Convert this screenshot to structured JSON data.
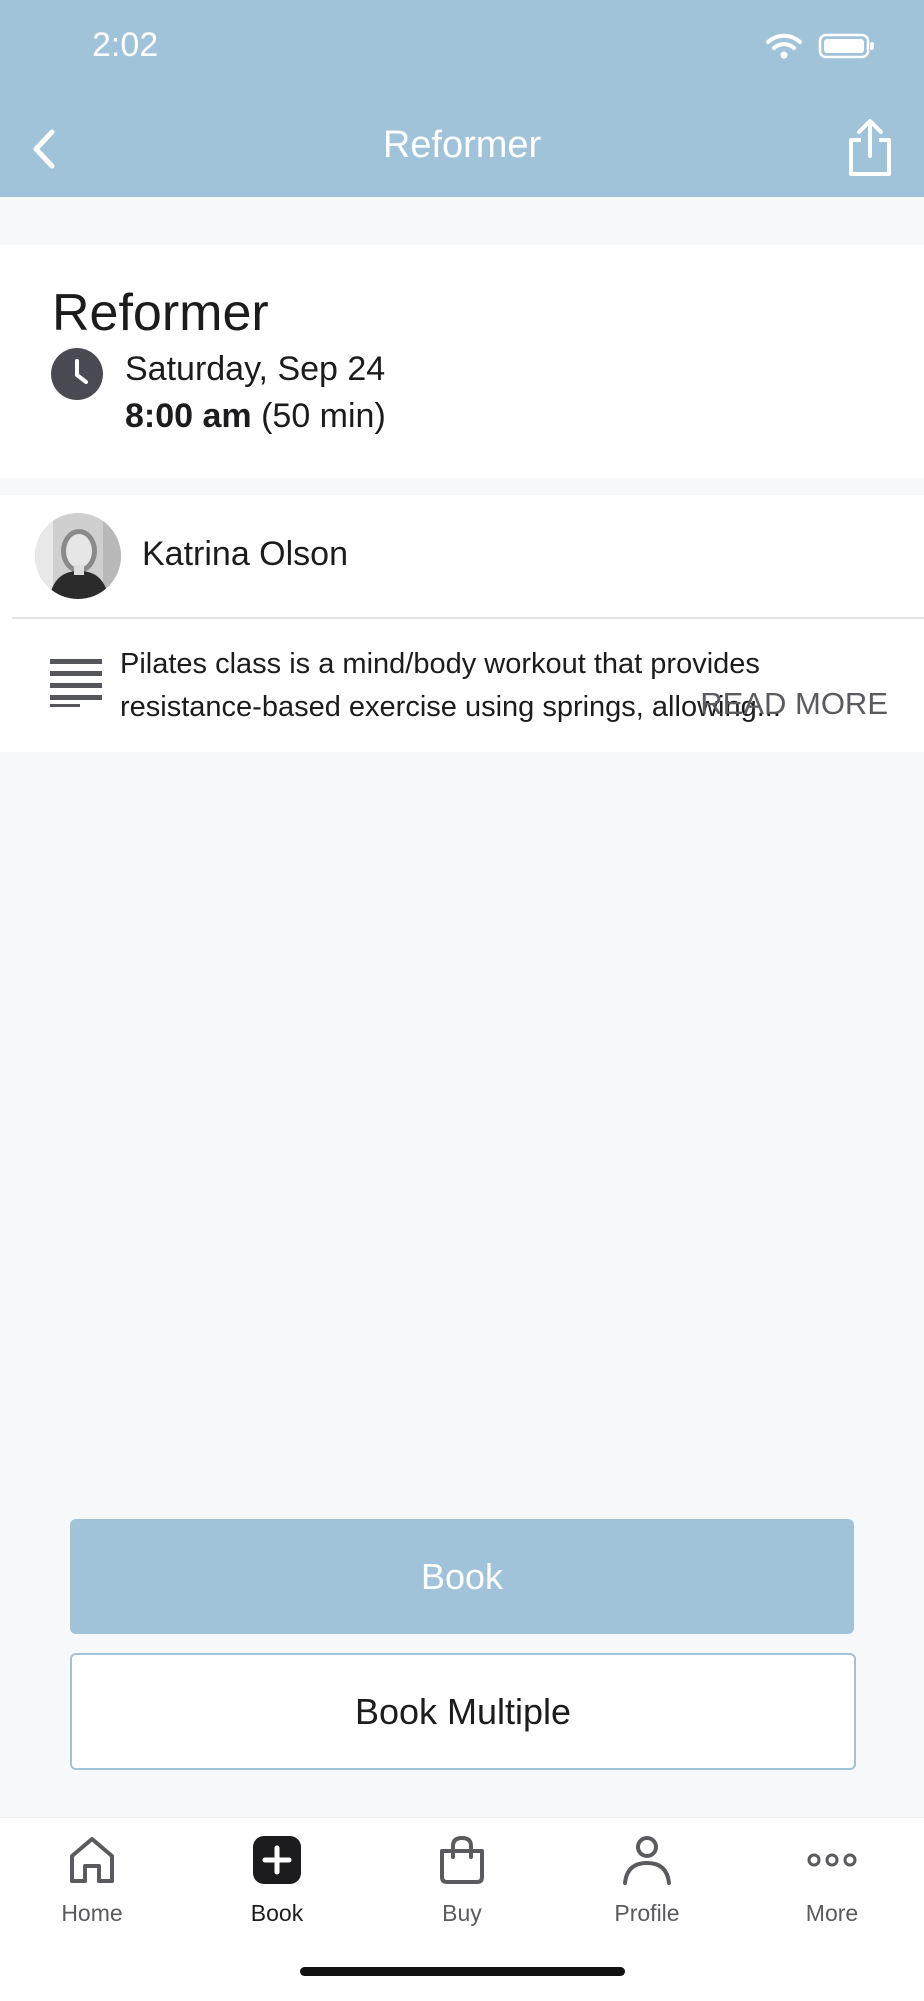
{
  "status_bar": {
    "time": "2:02"
  },
  "nav": {
    "title": "Reformer",
    "back_icon": "chevron-left-icon",
    "share_icon": "share-icon"
  },
  "class_info": {
    "title": "Reformer",
    "date": "Saturday, Sep 24",
    "start_time": "8:00 am",
    "duration": "(50 min)"
  },
  "instructor": {
    "name": "Katrina Olson"
  },
  "description": {
    "text": "Pilates class is a mind/body workout that provides resistance-based exercise using springs, allowing...",
    "read_more": "READ MORE"
  },
  "actions": {
    "book": "Book",
    "book_multiple": "Book Multiple"
  },
  "tabs": [
    {
      "label": "Home",
      "icon": "home-icon"
    },
    {
      "label": "Book",
      "icon": "plus-square-icon"
    },
    {
      "label": "Buy",
      "icon": "shopping-bag-icon"
    },
    {
      "label": "Profile",
      "icon": "person-icon"
    },
    {
      "label": "More",
      "icon": "more-dots-icon"
    }
  ],
  "colors": {
    "accent": "#a0c3da",
    "background": "#f7f8fa"
  }
}
